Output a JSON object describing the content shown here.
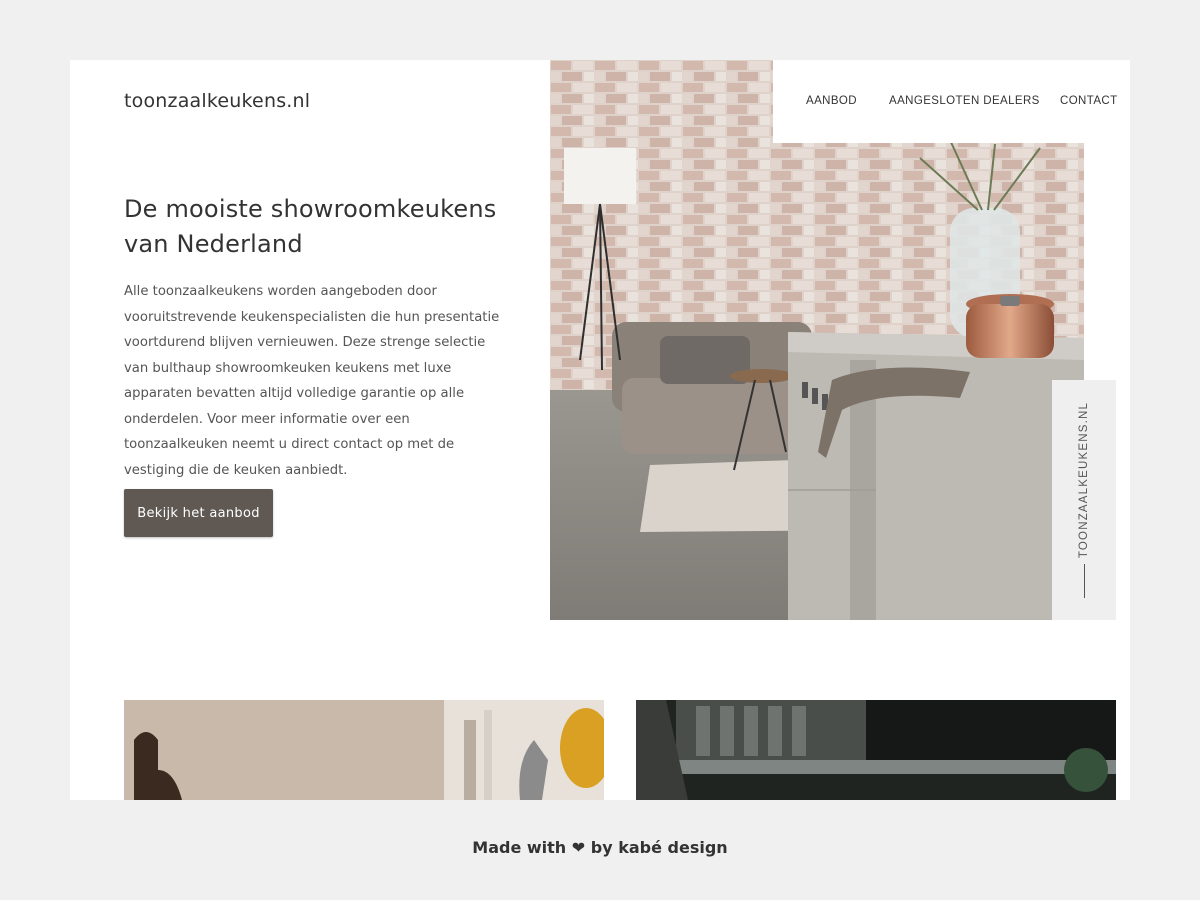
{
  "site": {
    "logo": "toonzaalkeukens.nl"
  },
  "nav": {
    "items": [
      {
        "label": "AANBOD"
      },
      {
        "label": "AANGESLOTEN DEALERS"
      },
      {
        "label": "CONTACT"
      }
    ]
  },
  "hero": {
    "title": "De mooiste showroomkeukens van Nederland",
    "body": "Alle toonzaalkeukens worden aangeboden door vooruitstrevende keukenspecialisten die hun presentatie voortdurend blijven vernieuwen. Deze strenge selectie van bulthaup showroomkeuken keukens met luxe apparaten bevatten altijd volledige garantie op alle onderdelen. Voor meer informatie over een toonzaalkeuken neemt u direct contact op met de vestiging die de keuken aanbiedt.",
    "cta_label": "Bekijk het aanbod"
  },
  "side_panel": {
    "text": "TOONZAALKEUKENS.NL"
  },
  "footer": {
    "prefix": "Made with",
    "heart": "❤",
    "suffix": "by kabé design"
  },
  "colors": {
    "page_bg": "#f0f0f0",
    "button_bg": "#5f5853",
    "text": "#333333"
  }
}
